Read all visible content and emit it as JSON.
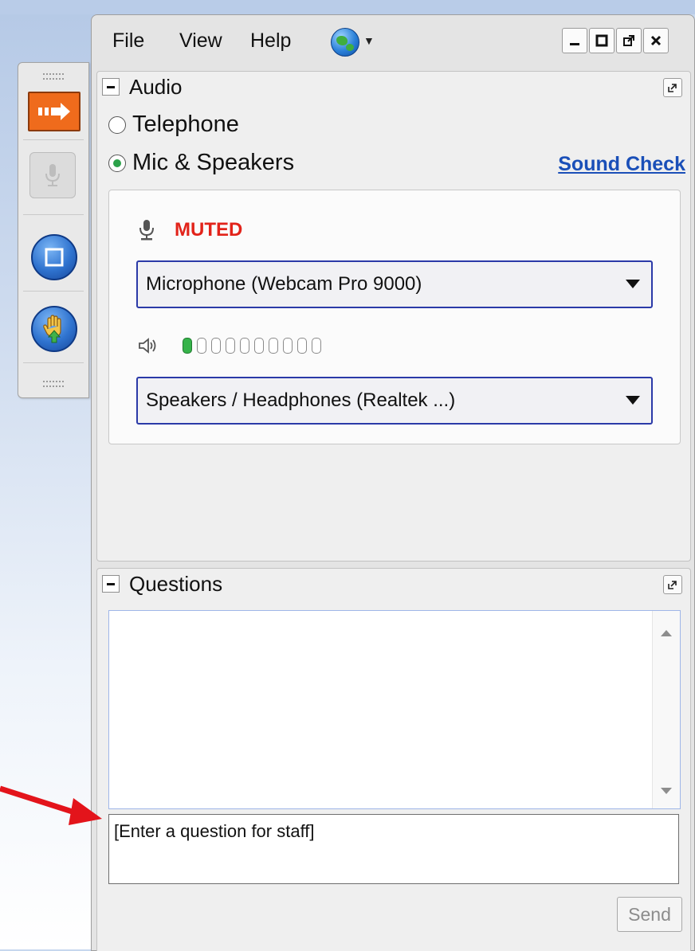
{
  "menu": {
    "file": "File",
    "view": "View",
    "help": "Help"
  },
  "window_controls": {
    "minimize": "—",
    "maximize": "☐",
    "popout": "⧉",
    "close": "✕"
  },
  "audio": {
    "title": "Audio",
    "telephone": "Telephone",
    "mic_speakers": "Mic & Speakers",
    "selected": "mic_speakers",
    "sound_check": "Sound Check",
    "status": "MUTED",
    "microphone_device": "Microphone (Webcam Pro 9000)",
    "speaker_device": "Speakers / Headphones (Realtek ...)",
    "speaker_level_lit": 1,
    "speaker_level_total": 10
  },
  "questions": {
    "title": "Questions",
    "input_placeholder": "[Enter a question for staff]",
    "send": "Send"
  },
  "icons": {
    "toolbar": [
      "arrow-icon",
      "microphone-icon",
      "screen-icon",
      "raise-hand-icon"
    ],
    "globe": "globe-icon",
    "popout": "popout-icon"
  },
  "colors": {
    "muted": "#e2231a",
    "link": "#1a4fb8",
    "dropdown_border": "#2b3aa8",
    "toolbar_arrow": "#ef6b1c",
    "level_on": "#36b34a",
    "annotation_arrow": "#e3141b"
  }
}
